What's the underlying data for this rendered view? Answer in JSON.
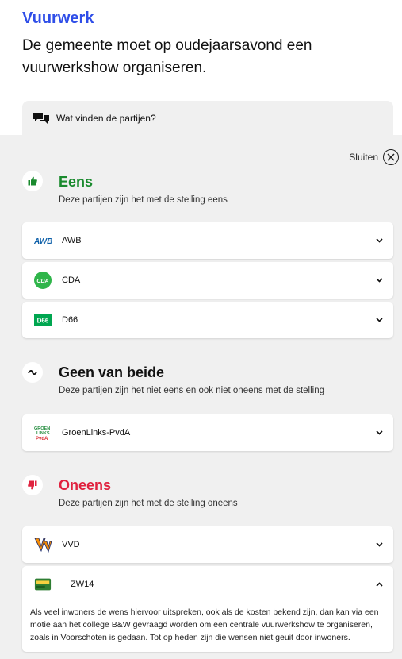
{
  "topic": "Vuurwerk",
  "statement": "De gemeente moet op oudejaarsavond een vuurwerkshow organiseren.",
  "parties_toggle": {
    "label": "Wat vinden de partijen?",
    "icon": "chat-bubbles-icon"
  },
  "close": {
    "label": "Sluiten",
    "icon": "close-icon"
  },
  "categories": {
    "agree": {
      "title": "Eens",
      "description": "Deze partijen zijn het met de stelling eens",
      "icon": "thumbs-up-icon",
      "color": "#1a8a2e",
      "parties": [
        {
          "name": "AWB",
          "logo": "awb-logo"
        },
        {
          "name": "CDA",
          "logo": "cda-logo"
        },
        {
          "name": "D66",
          "logo": "d66-logo"
        }
      ]
    },
    "neutral": {
      "title": "Geen van beide",
      "description": "Deze partijen zijn het niet eens en ook niet oneens met de stelling",
      "icon": "tilde-icon",
      "color": "#111111",
      "parties": [
        {
          "name": "GroenLinks-PvdA",
          "logo": "groenlinks-pvda-logo"
        }
      ]
    },
    "disagree": {
      "title": "Oneens",
      "description": "Deze partijen zijn het met de stelling oneens",
      "icon": "thumbs-down-icon",
      "color": "#e0223f",
      "parties": [
        {
          "name": "VVD",
          "logo": "vvd-logo"
        },
        {
          "name": "ZW14",
          "logo": "zw14-logo",
          "expanded": true,
          "explanation": "Als veel inwoners de wens hiervoor uitspreken, ook als de kosten bekend zijn, dan kan via een motie aan het college B&W gevraagd worden om een centrale vuurwerkshow te organiseren, zoals in Voorschoten is gedaan. Tot op heden zijn die wensen niet geuit door inwoners."
        }
      ]
    }
  }
}
